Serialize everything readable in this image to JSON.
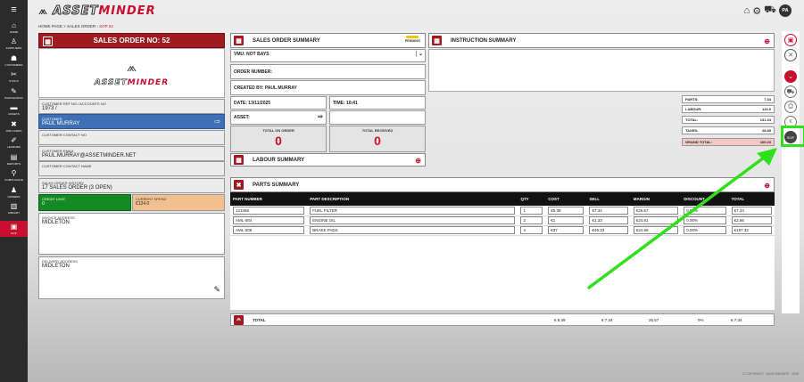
{
  "sidebar": {
    "items": [
      {
        "label": "HOME",
        "icon": "home-icon",
        "glyph": "⌂"
      },
      {
        "label": "SUPPLIERS",
        "icon": "suppliers-icon",
        "glyph": "♙"
      },
      {
        "label": "CUSTOMERS",
        "icon": "customers-icon",
        "glyph": "☗"
      },
      {
        "label": "STOCK",
        "icon": "stock-icon",
        "glyph": "✂"
      },
      {
        "label": "PURCHASING",
        "icon": "purchasing-icon",
        "glyph": "✎"
      },
      {
        "label": "ASSETS",
        "icon": "assets-icon",
        "glyph": "▬"
      },
      {
        "label": "JOB CARDS",
        "icon": "job-cards-icon",
        "glyph": "✖"
      },
      {
        "label": "LEARNER",
        "icon": "learner-icon",
        "glyph": "✐"
      },
      {
        "label": "REPORTS",
        "icon": "reports-icon",
        "glyph": "▤"
      },
      {
        "label": "COMPLIANCE",
        "icon": "compliance-icon",
        "glyph": "⚲"
      },
      {
        "label": "OWNERS",
        "icon": "owners-icon",
        "glyph": "♟"
      },
      {
        "label": "LIBRARY",
        "icon": "library-icon",
        "glyph": "▥"
      },
      {
        "label": "SOP",
        "icon": "sop-icon",
        "glyph": "▣"
      }
    ]
  },
  "logo": {
    "part1": "ASSET",
    "part2": "MINDER"
  },
  "topbar": {
    "avatar": "PA"
  },
  "breadcrumb": {
    "home": "HOME PAGE",
    "sep": ">",
    "section": "SALES ORDER",
    "current": "SOP 52"
  },
  "order": {
    "title": "SALES ORDER NO: 52"
  },
  "customer": {
    "ref_label": "CUSTOMER REF NO / ACCOUNTS NO",
    "ref_value": "1973 /",
    "customer_label": "CUSTOMER",
    "customer_value": "PAUL MURRAY",
    "contact_no_label": "CUSTOMER CONTACT NO",
    "contact_no_value": "",
    "email_label": "CUSTOMER EMAIL",
    "email_value": "PAUL.MURRAY@ASSETMINDER.NET",
    "contact_name_label": "CUSTOMER CONTACT NAME",
    "contact_name_value": "",
    "history_label": "SALES ORDER HISTORY",
    "history_value": "17 SALES ORDER (3 OPEN)",
    "credit_label": "CREDIT LIMIT",
    "credit_value": "0",
    "spend_label": "CURRENT SPEND",
    "spend_value": "€124.0",
    "invoice_label": "INVOICE ADDRESS",
    "invoice_value": "MIDLETON",
    "delivery_label": "DELIVERY ADDRESS",
    "delivery_value": "MIDLETON"
  },
  "summary": {
    "title": "SALES ORDER SUMMARY",
    "status": "PENDING",
    "vmu": "VMU: NOT BAYS",
    "order_number": "ORDER NUMBER:",
    "created_by": "CREATED BY: PAUL MURRAY",
    "date": "DATE: 13/11/2025",
    "time": "TIME: 10:41",
    "asset": "ASSET:",
    "total_on_order_label": "TOTAL ON ORDER",
    "total_on_order": "0",
    "total_received_label": "TOTAL RECEIVED",
    "total_received": "0"
  },
  "instruction": {
    "title": "INSTRUCTION SUMMARY"
  },
  "labour": {
    "title": "LABOUR SUMMARY"
  },
  "totals": [
    {
      "label": "PARTS:",
      "value": "7.34"
    },
    {
      "label": "LABOUR:",
      "value": "124.0"
    },
    {
      "label": "TOTAL:",
      "value": "131.34"
    },
    {
      "label": "TAXES:",
      "value": "28.89"
    },
    {
      "label": "GRAND TOTAL:",
      "value": "160.23"
    }
  ],
  "parts": {
    "title": "PARTS SUMMARY",
    "columns": [
      "PART NUMBER",
      "PART DESCRIPTION",
      "QTY",
      "COST",
      "SELL",
      "MARGIN",
      "DISCOUNT",
      "TOTAL"
    ],
    "rows": [
      {
        "num": "123456",
        "desc": "FUEL FILTER",
        "qty": "1",
        "cost": "€5.39",
        "sell": "€7.34",
        "margin": "€26.57",
        "disc": "0.00%",
        "total": "€7.34"
      },
      {
        "num": "AML-004",
        "desc": "ENGINE OIL",
        "qty": "2",
        "cost": "€1",
        "sell": "€1.33",
        "margin": "€24.81",
        "disc": "0.00%",
        "total": "€2.66"
      },
      {
        "num": "AML-005",
        "desc": "BRAKE PADS",
        "qty": "4",
        "cost": "€37",
        "sell": "€49.33",
        "margin": "€24.89",
        "disc": "0.00%",
        "total": "€197.32"
      }
    ],
    "footer": {
      "label": "TOTAL",
      "cost": "€ 5.39",
      "sell": "€ 7.34",
      "margin": "26.57",
      "disc": "0%",
      "total": "€ 7.34"
    }
  },
  "copyright": "© COPYRIGHT · ASSETMINDER · 2025",
  "colors": {
    "brand_red": "#c8102e",
    "highlight": "#2fe01c",
    "sidebar": "#2b2b2b"
  }
}
